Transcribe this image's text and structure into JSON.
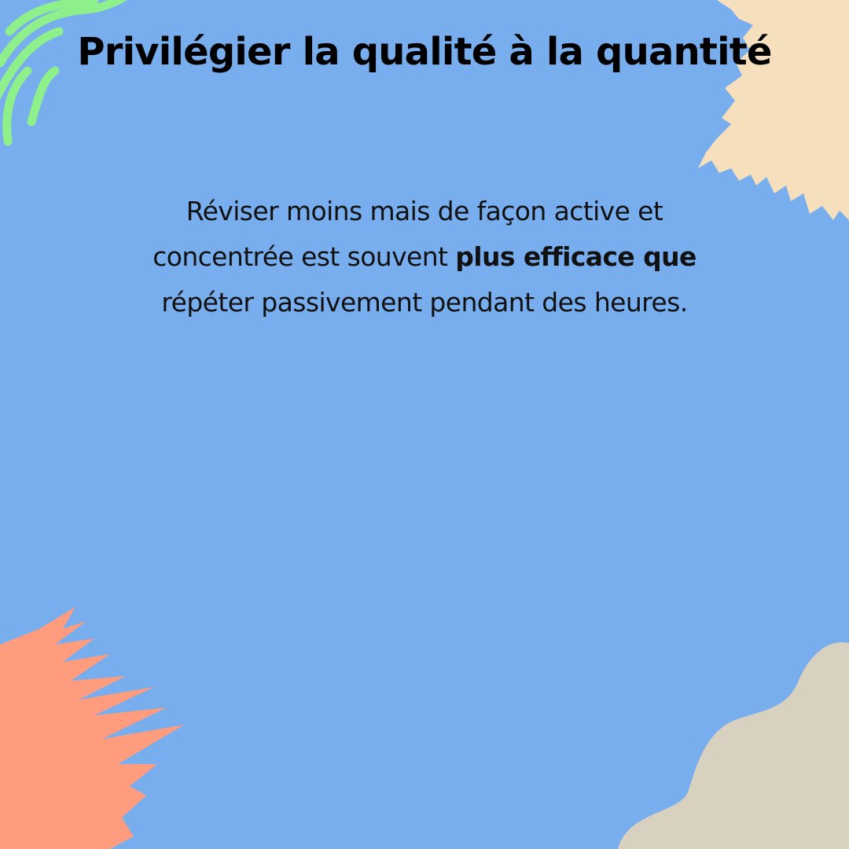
{
  "title": "Privilégier la qualité à la quantité",
  "body": {
    "part1": "Réviser moins mais de façon active et concentrée est souvent ",
    "bold": "plus efficace que",
    "part2": " répéter passivement pendant des heures."
  },
  "decorations": {
    "green_waves_icon": "green-wavy-lines",
    "beige_brush_icon": "beige-brush-stroke",
    "orange_brush_icon": "orange-brush-stroke",
    "taupe_blob_icon": "taupe-blob"
  },
  "colors": {
    "background": "#78adee",
    "green": "#8ef08a",
    "beige": "#f6dfbd",
    "orange": "#ff9c7d",
    "taupe": "#d8d1c0",
    "text": "#000000"
  }
}
